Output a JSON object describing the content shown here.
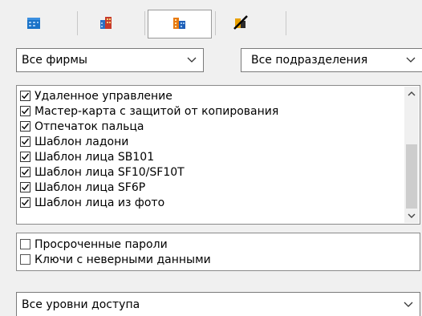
{
  "toolbar": {
    "buttons": [
      {
        "icon": "blue-building-icon",
        "color": "#1a73c8",
        "active": false
      },
      {
        "icon": "colored-building-icon",
        "color": "#2b6fc4",
        "active": false
      },
      {
        "icon": "orange-building-icon",
        "color": "#e87a12",
        "active": true
      },
      {
        "icon": "crossed-out-building-icon",
        "color": "#e8a000",
        "active": false
      }
    ]
  },
  "filters": {
    "company": "Все фирмы",
    "department": "Все подразделения",
    "access_level": "Все уровни доступа"
  },
  "credential_types": {
    "items": [
      {
        "label": "Удаленное управление",
        "checked": true
      },
      {
        "label": "Мастер-карта с защитой от копирования",
        "checked": true
      },
      {
        "label": "Отпечаток пальца",
        "checked": true
      },
      {
        "label": "Шаблон ладони",
        "checked": true
      },
      {
        "label": "Шаблон лица SB101",
        "checked": true
      },
      {
        "label": "Шаблон лица SF10/SF10T",
        "checked": true
      },
      {
        "label": "Шаблон лица SF6P",
        "checked": true
      },
      {
        "label": "Шаблон лица из фото",
        "checked": true
      }
    ],
    "scroll_position": 0.62
  },
  "extra_filters": {
    "items": [
      {
        "label": "Просроченные пароли",
        "checked": false
      },
      {
        "label": "Ключи с неверными данными",
        "checked": false
      }
    ]
  },
  "colors": {
    "window_bg": "#f0f0f0",
    "border": "#7a7a7a",
    "checkmark": "#000000"
  }
}
